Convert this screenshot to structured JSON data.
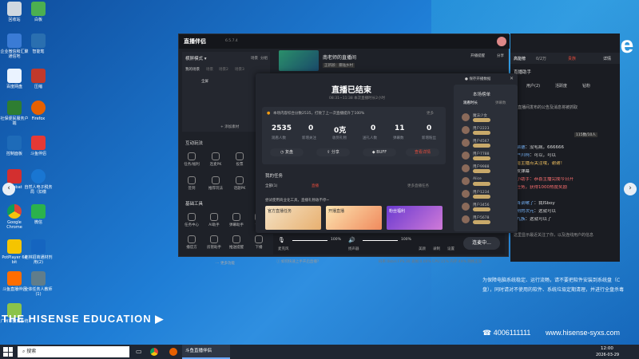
{
  "desktop": {
    "icons": [
      {
        "label": "回收站",
        "color": "#d0d8e0"
      },
      {
        "label": "白板",
        "color": "#4caf50"
      },
      {
        "label": "企业微信和汇聚通信地",
        "color": "#3a7bd5"
      },
      {
        "label": "智能笔",
        "color": "#2a6fb0"
      },
      {
        "label": "百度网盘",
        "color": "#eaf3ff"
      },
      {
        "label": "压缩",
        "color": "#c0392b"
      },
      {
        "label": "社保便民服务户端",
        "color": "#2e7d32"
      },
      {
        "label": "Firefox",
        "color": "#e66000"
      },
      {
        "label": "控制面板",
        "color": "#1e6bb8"
      },
      {
        "label": "斗鱼伴侣",
        "color": "#e53935"
      },
      {
        "label": "Acrobat",
        "color": "#d32f2f"
      },
      {
        "label": "自然人电子税务局（扣缴",
        "color": "#1976d2"
      },
      {
        "label": "Google Chrome",
        "color": "#f4c20d"
      },
      {
        "label": "微信",
        "color": "#2bb24c"
      },
      {
        "label": "PotPlayer 64 bit",
        "color": "#f5c400"
      },
      {
        "label": "连林招商通材剂用(2)",
        "color": "#1565c0"
      },
      {
        "label": "斗鱼直播伴侣",
        "color": "#ff6d00"
      },
      {
        "label": "全体任务人教师(1)",
        "color": "#607d8b"
      },
      {
        "label": "广州市教育系统",
        "color": "#8bc34a"
      }
    ],
    "edu_text": "THE HISENSE EDUCATION",
    "logo_text": "se",
    "phone": "4006111111",
    "website": "www.hisense-syxs.com",
    "notice": "为保障电脑系统稳定、运行流畅，请不要把软件安装到系统盘（C盘），同时请对不使用的软件、系统垃圾定期清理，并进行全盘杀毒"
  },
  "app": {
    "logo": "直播伴侣",
    "version": "6.5.7.4",
    "room_title": "南老师的直播间",
    "badge": "正新辦：暴陆乡村",
    "scene_mode": "横屏模式",
    "scene_tabs": [
      "场景",
      "分组"
    ],
    "my_scene": "我的场景",
    "scene_sub": [
      "场景",
      "场景2",
      "场景3"
    ],
    "scene_item": "全屏",
    "add_material": "添加素材",
    "interaction_title": "互动玩法",
    "interaction_tools": [
      "任务/福利",
      "连麦PK",
      "投票",
      "签到",
      "推荐玩法",
      "主播已经",
      "话题PK",
      "主题"
    ],
    "basic_tools_title": "基础工具",
    "basic_tools": [
      "任务中心",
      "AI助手",
      "弹幕助手",
      "设置",
      "播官方",
      "房管助手",
      "推送提醒",
      "录屏",
      "下播"
    ],
    "more": "更多功能",
    "header_right": [
      "开播提醒",
      "分享"
    ],
    "bottom": {
      "mic_label": "麦克风",
      "mic_pct": "100%",
      "spk_label": "扬声器",
      "spk_pct": "100%",
      "extra": [
        "美颜",
        "录制",
        "设置"
      ],
      "live_btn": "连麦中...",
      "status": [
        "码率:0kb/s",
        "FPS:30",
        "丢帧:0.00%",
        "CPU:15%",
        "内存:49%",
        "网络正常"
      ]
    },
    "hint": "如何快速上手开启直播？"
  },
  "modal": {
    "title": "直播已结束",
    "subtitle": "08:31~11:38 本次直播时长2小时",
    "save_label": "保存开播数据",
    "info": "本场内容综合分数2535，打败了上一次直播提升了100%",
    "more": "更多",
    "stats": [
      {
        "v": "2535",
        "l": "观看人数"
      },
      {
        "v": "0",
        "l": "新增关注"
      },
      {
        "v": "0克",
        "l": "收到礼物"
      },
      {
        "v": "0",
        "l": "送礼人数"
      },
      {
        "v": "11",
        "l": "弹幕数"
      },
      {
        "v": "0",
        "l": "新增粉丝"
      }
    ],
    "actions": [
      "复盘",
      "分享",
      "BUFF",
      "查看详情"
    ],
    "task_title": "我的任务",
    "task_tabs": [
      "全部(1)",
      "直播"
    ],
    "task_more": "更多直播任务",
    "task_banner": "尝试使用商业化工具，直播礼物收不停~",
    "cards": [
      "官方直播任务",
      "开播直播",
      "粉丝福利"
    ],
    "rank_title": "本场榜单",
    "rank_cols": [
      "观看时长",
      "弹幕数"
    ],
    "rank_names": [
      "魔法少女",
      "用户2223",
      "用户4567",
      "用户7788",
      "用户9988",
      "Alice",
      "用户1234",
      "用户3456",
      "用户5678",
      "用户1357"
    ]
  },
  "panel": {
    "header_title": "高能榜",
    "rank_count": "0/2万",
    "vip": "贵族",
    "detail": "详情",
    "assistant": "直播助手",
    "tabs": [
      "用户(2)",
      "活跃度",
      "钻粉"
    ],
    "tip": "在直播间发布的公告及消息将被抓取",
    "count": "115数/10人",
    "chats": [
      {
        "u": "壹启德",
        "t": "没毛病，666666"
      },
      {
        "u": "江户川柯",
        "t": "可以，可以"
      },
      {
        "u": "",
        "t": "请给主播点关注哦，谢谢！"
      },
      {
        "u": "",
        "t": "及发弹幕"
      },
      {
        "u": "播小助手",
        "t": "恭喜主播完成今日开"
      },
      {
        "u": "",
        "t": "始任务，获得1000热度奖励"
      },
      {
        "u": "元首训嗽了",
        "t": "我ISboy"
      },
      {
        "u": "我刚的次元",
        "t": "这就可以"
      },
      {
        "u": "帮九族",
        "t": "这就可以了"
      }
    ],
    "footer": "这里显示最近关注了你，以及连线用户的信息"
  },
  "taskbar": {
    "search": "搜索",
    "task_app": "斗鱼直播伴侣",
    "time": "12:00",
    "date": "2026-03-29"
  }
}
